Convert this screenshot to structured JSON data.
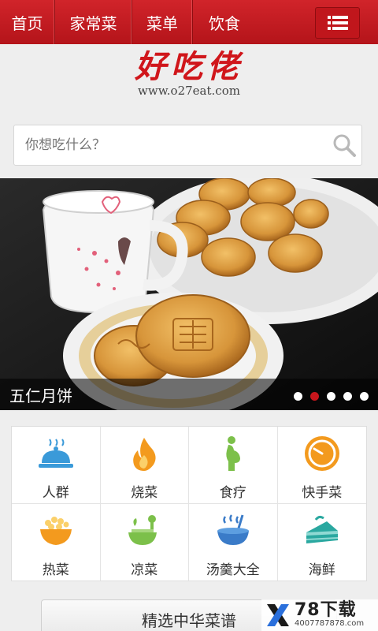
{
  "nav": {
    "items": [
      {
        "label": "首页"
      },
      {
        "label": "家常菜"
      },
      {
        "label": "菜单"
      },
      {
        "label": "饮食"
      }
    ],
    "menu_icon": "list-menu-icon"
  },
  "logo": {
    "title": "好吃佬",
    "url": "www.o27eat.com"
  },
  "search": {
    "placeholder": "你想吃什么？",
    "icon": "search-icon"
  },
  "banner": {
    "caption": "五仁月饼",
    "slide_count": 5,
    "active_slide": 2
  },
  "categories": [
    {
      "label": "人群",
      "icon": "cloche-icon"
    },
    {
      "label": "烧菜",
      "icon": "flame-icon"
    },
    {
      "label": "食疗",
      "icon": "pregnant-woman-icon"
    },
    {
      "label": "快手菜",
      "icon": "clock-icon"
    },
    {
      "label": "热菜",
      "icon": "hot-bowl-icon"
    },
    {
      "label": "凉菜",
      "icon": "salad-bowl-icon"
    },
    {
      "label": "汤羹大全",
      "icon": "soup-pot-icon"
    },
    {
      "label": "海鲜",
      "icon": "cake-slice-icon"
    }
  ],
  "bottom_button": {
    "label": "精选中华菜谱"
  },
  "watermark": {
    "brand": "78下载",
    "phone": "4007787878.com"
  },
  "colors": {
    "brand_red": "#c8161c",
    "icon_blue": "#3a9ad9",
    "icon_orange": "#f39a1e",
    "icon_green": "#7cc04a"
  }
}
